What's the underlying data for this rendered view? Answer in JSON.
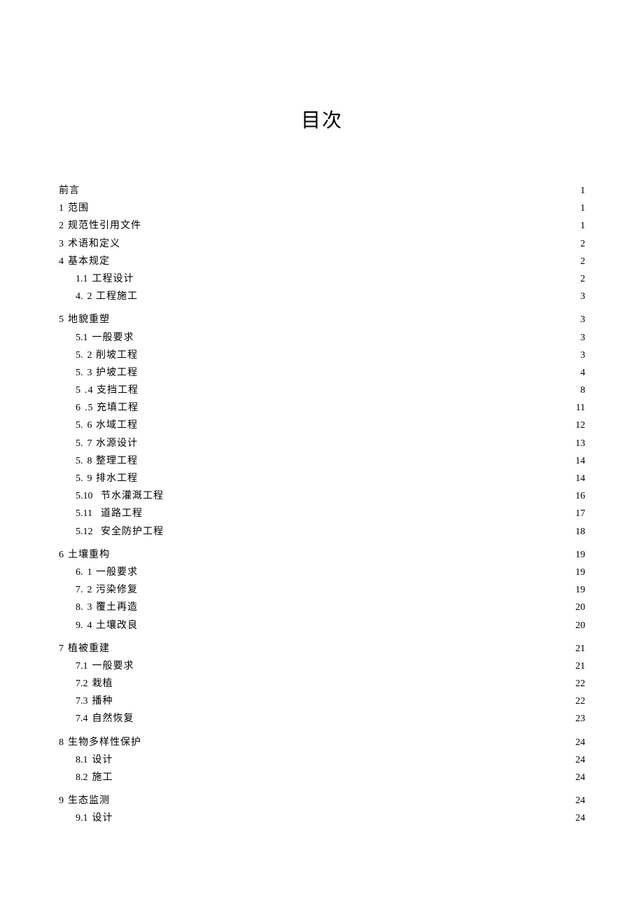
{
  "title": "目次",
  "entries": [
    {
      "level": 0,
      "num": "",
      "label": "前言",
      "page": "1",
      "gap": false
    },
    {
      "level": 0,
      "num": "1",
      "label": "范围",
      "page": "1",
      "gap": false
    },
    {
      "level": 0,
      "num": "2",
      "label": "规范性引用文件",
      "page": "1",
      "gap": false
    },
    {
      "level": 0,
      "num": "3",
      "label": "术语和定义",
      "page": "2",
      "gap": false
    },
    {
      "level": 0,
      "num": "4",
      "label": "基本规定",
      "page": "2",
      "gap": false
    },
    {
      "level": 1,
      "num": "1.1",
      "label": "工程设计",
      "page": "2",
      "gap": false
    },
    {
      "level": 1,
      "num": "4.",
      "label": "2 工程施工",
      "page": "3",
      "gap": false
    },
    {
      "level": 0,
      "num": "5",
      "label": "地貌重塑",
      "page": "3",
      "gap": true
    },
    {
      "level": 1,
      "num": "5.1",
      "label": "一般要求",
      "page": "3",
      "gap": false
    },
    {
      "level": 1,
      "num": "5.",
      "label": "2 削坡工程",
      "page": "3",
      "gap": false
    },
    {
      "level": 1,
      "num": "5.",
      "label": "3 护坡工程",
      "page": "4",
      "gap": false
    },
    {
      "level": 1,
      "num": "5",
      "label": ".4 支挡工程",
      "page": "8",
      "gap": false
    },
    {
      "level": 1,
      "num": "6",
      "label": ".5 充填工程",
      "page": "11",
      "gap": false
    },
    {
      "level": 1,
      "num": "5.",
      "label": "6 水域工程",
      "page": "12",
      "gap": false
    },
    {
      "level": 1,
      "num": "5.",
      "label": "7 水源设计",
      "page": "13",
      "gap": false
    },
    {
      "level": 1,
      "num": "5.",
      "label": "8 整理工程",
      "page": "14",
      "gap": false
    },
    {
      "level": 1,
      "num": "5.",
      "label": "9 排水工程",
      "page": "14",
      "gap": false
    },
    {
      "level": 1,
      "num": "5.10",
      "label": "节水灌溉工程",
      "page": "16",
      "gap": false,
      "wide": true
    },
    {
      "level": 1,
      "num": "5.11",
      "label": "道路工程",
      "page": "17",
      "gap": false,
      "wide": true
    },
    {
      "level": 1,
      "num": "5.12",
      "label": "安全防护工程",
      "page": "18",
      "gap": false,
      "wide": true
    },
    {
      "level": 0,
      "num": "6",
      "label": "土壤重构",
      "page": "19",
      "gap": true
    },
    {
      "level": 1,
      "num": "6.",
      "label": "1 一般要求",
      "page": "19",
      "gap": false
    },
    {
      "level": 1,
      "num": "7.",
      "label": "2 污染修复",
      "page": "19",
      "gap": false
    },
    {
      "level": 1,
      "num": "8.",
      "label": "3 覆土再造",
      "page": "20",
      "gap": false
    },
    {
      "level": 1,
      "num": "9.",
      "label": "4 土壤改良",
      "page": "20",
      "gap": false
    },
    {
      "level": 0,
      "num": "7",
      "label": "植被重建",
      "page": "21",
      "gap": true
    },
    {
      "level": 1,
      "num": "7.1",
      "label": "一般要求",
      "page": "21",
      "gap": false
    },
    {
      "level": 1,
      "num": "7.2",
      "label": "栽植",
      "page": "22",
      "gap": false
    },
    {
      "level": 1,
      "num": "7.3",
      "label": "播种",
      "page": "22",
      "gap": false
    },
    {
      "level": 1,
      "num": "7.4",
      "label": "自然恢复",
      "page": "23",
      "gap": false
    },
    {
      "level": 0,
      "num": "8",
      "label": "生物多样性保护",
      "page": "24",
      "gap": true
    },
    {
      "level": 1,
      "num": "8.1",
      "label": "设计",
      "page": "24",
      "gap": false
    },
    {
      "level": 1,
      "num": "8.2",
      "label": "施工",
      "page": "24",
      "gap": false
    },
    {
      "level": 0,
      "num": "9",
      "label": "生态监测",
      "page": "24",
      "gap": true
    },
    {
      "level": 1,
      "num": "9.1",
      "label": "设计",
      "page": "24",
      "gap": false
    }
  ]
}
